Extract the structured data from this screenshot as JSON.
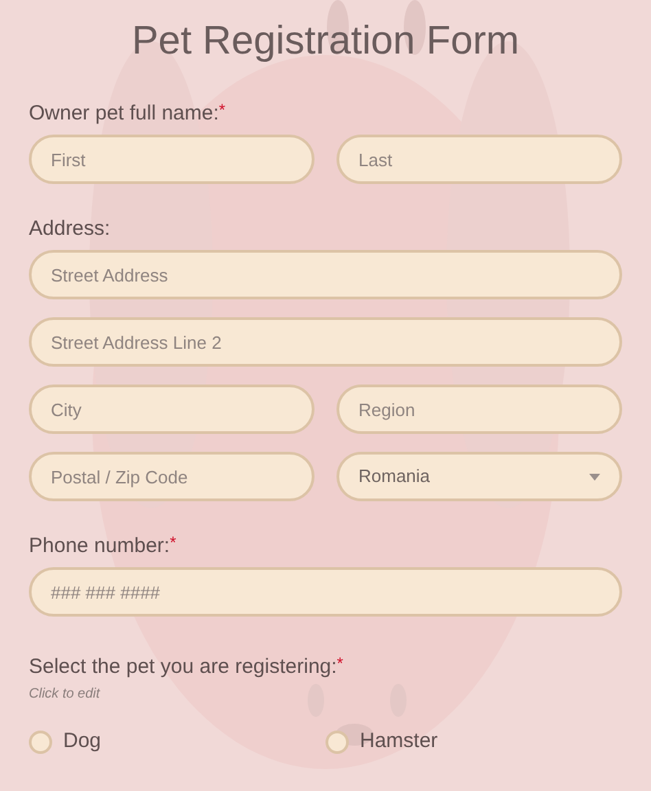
{
  "title": "Pet Registration Form",
  "sections": [
    {
      "label": "Owner pet full name:",
      "required_mark": "*",
      "rows": [
        [
          {
            "kind": "text",
            "placeholder": "First"
          },
          {
            "kind": "text",
            "placeholder": "Last"
          }
        ]
      ]
    },
    {
      "label": "Address:",
      "rows": [
        [
          {
            "kind": "text",
            "placeholder": "Street Address"
          }
        ],
        [
          {
            "kind": "text",
            "placeholder": "Street Address Line 2"
          }
        ],
        [
          {
            "kind": "text",
            "placeholder": "City"
          },
          {
            "kind": "text",
            "placeholder": "Region"
          }
        ],
        [
          {
            "kind": "text",
            "placeholder": "Postal / Zip Code"
          },
          {
            "kind": "select",
            "value": "Romania"
          }
        ]
      ]
    },
    {
      "label": "Phone number:",
      "required_mark": "*",
      "rows": [
        [
          {
            "kind": "text",
            "placeholder": "### ### ####"
          }
        ]
      ]
    }
  ],
  "pet_question": {
    "label": "Select the pet you are registering:",
    "required_mark": "*",
    "hint": "Click to edit",
    "options": [
      {
        "label": "Dog",
        "selected": false
      },
      {
        "label": "Hamster",
        "selected": false
      }
    ]
  }
}
